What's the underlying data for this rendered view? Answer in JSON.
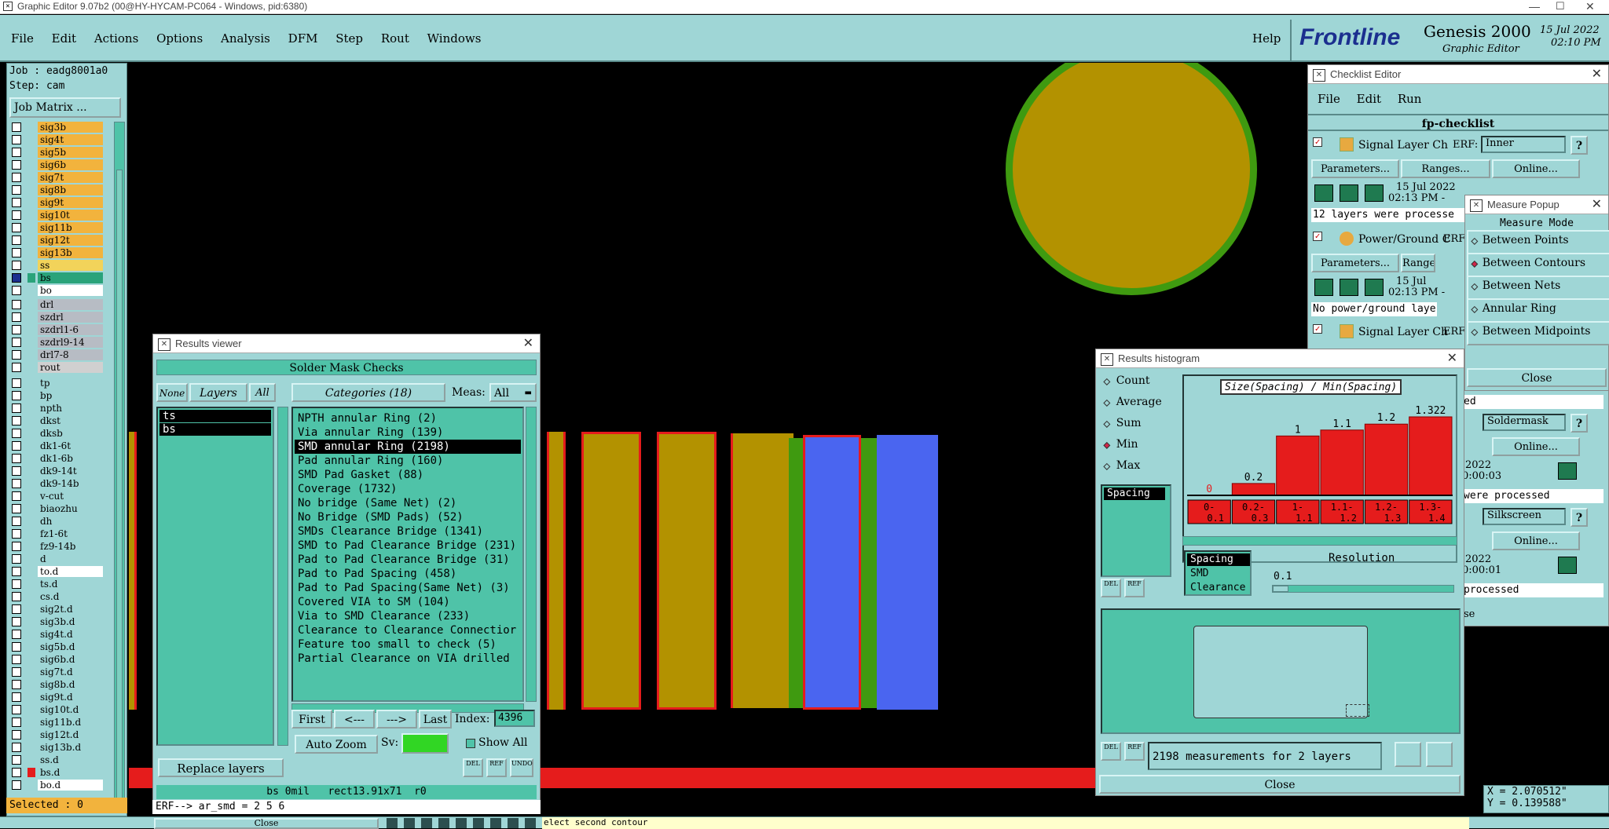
{
  "titlebar": {
    "title": "Graphic Editor 9.07b2 (00@HY-HYCAM-PC064 - Windows, pid:6380)"
  },
  "menu": {
    "items": [
      "File",
      "Edit",
      "Actions",
      "Options",
      "Analysis",
      "DFM",
      "Step",
      "Rout",
      "Windows"
    ],
    "help": "Help"
  },
  "brand": {
    "logo": "Frontline",
    "product": "Genesis 2000",
    "subtitle": "Graphic Editor",
    "date": "15 Jul 2022",
    "time": "02:10 PM"
  },
  "job": {
    "job": "Job : eadg8001a0",
    "step": "Step: cam",
    "matrix_button": "Job Matrix ...",
    "selected": "Selected : 0"
  },
  "layers": [
    {
      "name": "sig3b",
      "color": "#f2b33d"
    },
    {
      "name": "sig4t",
      "color": "#f2b33d"
    },
    {
      "name": "sig5b",
      "color": "#f2b33d"
    },
    {
      "name": "sig6b",
      "color": "#f2b33d"
    },
    {
      "name": "sig7t",
      "color": "#f2b33d"
    },
    {
      "name": "sig8b",
      "color": "#f2b33d"
    },
    {
      "name": "sig9t",
      "color": "#f2b33d"
    },
    {
      "name": "sig10t",
      "color": "#f2b33d"
    },
    {
      "name": "sig11b",
      "color": "#f2b33d"
    },
    {
      "name": "sig12t",
      "color": "#f2b33d"
    },
    {
      "name": "sig13b",
      "color": "#f2b33d"
    },
    {
      "name": "ss",
      "color": "#f2d35a"
    },
    {
      "name": "bs",
      "color": "#2aa37a",
      "active": true
    },
    {
      "name": "bo",
      "color": "#ffffff"
    },
    {
      "name": "drl",
      "color": "#b7bcc4"
    },
    {
      "name": "szdrl",
      "color": "#b7bcc4"
    },
    {
      "name": "szdrl1-6",
      "color": "#b7bcc4"
    },
    {
      "name": "szdrl9-14",
      "color": "#b7bcc4"
    },
    {
      "name": "drl7-8",
      "color": "#b7bcc4"
    },
    {
      "name": "rout",
      "color": "#d0d0d0"
    },
    {
      "name": "tp",
      "color": "#9fd6d6"
    },
    {
      "name": "bp",
      "color": "#9fd6d6"
    },
    {
      "name": "npth",
      "color": "#9fd6d6"
    },
    {
      "name": "dkst",
      "color": "#9fd6d6"
    },
    {
      "name": "dksb",
      "color": "#9fd6d6"
    },
    {
      "name": "dk1-6t",
      "color": "#9fd6d6"
    },
    {
      "name": "dk1-6b",
      "color": "#9fd6d6"
    },
    {
      "name": "dk9-14t",
      "color": "#9fd6d6"
    },
    {
      "name": "dk9-14b",
      "color": "#9fd6d6"
    },
    {
      "name": "v-cut",
      "color": "#9fd6d6"
    },
    {
      "name": "biaozhu",
      "color": "#9fd6d6"
    },
    {
      "name": "dh",
      "color": "#9fd6d6"
    },
    {
      "name": "fz1-6t",
      "color": "#9fd6d6"
    },
    {
      "name": "fz9-14b",
      "color": "#9fd6d6"
    },
    {
      "name": "d",
      "color": "#9fd6d6"
    },
    {
      "name": "to.d",
      "color": "#ffffff"
    },
    {
      "name": "ts.d",
      "color": "#9fd6d6"
    },
    {
      "name": "cs.d",
      "color": "#9fd6d6"
    },
    {
      "name": "sig2t.d",
      "color": "#9fd6d6"
    },
    {
      "name": "sig3b.d",
      "color": "#9fd6d6"
    },
    {
      "name": "sig4t.d",
      "color": "#9fd6d6"
    },
    {
      "name": "sig5b.d",
      "color": "#9fd6d6"
    },
    {
      "name": "sig6b.d",
      "color": "#9fd6d6"
    },
    {
      "name": "sig7t.d",
      "color": "#9fd6d6"
    },
    {
      "name": "sig8b.d",
      "color": "#9fd6d6"
    },
    {
      "name": "sig9t.d",
      "color": "#9fd6d6"
    },
    {
      "name": "sig10t.d",
      "color": "#9fd6d6"
    },
    {
      "name": "sig11b.d",
      "color": "#9fd6d6"
    },
    {
      "name": "sig12t.d",
      "color": "#9fd6d6"
    },
    {
      "name": "sig13b.d",
      "color": "#9fd6d6"
    },
    {
      "name": "ss.d",
      "color": "#9fd6d6"
    },
    {
      "name": "bs.d",
      "color": "#9fd6d6"
    },
    {
      "name": "bo.d",
      "color": "#ffffff"
    }
  ],
  "results_viewer": {
    "title": "Results viewer",
    "header": "Solder Mask Checks",
    "none_btn": "None",
    "layers_btn": "Layers",
    "all_btn": "All",
    "categories_label": "Categories (18)",
    "meas_label": "Meas:",
    "meas_value": "All",
    "layer_items": [
      "ts",
      "bs"
    ],
    "categories": [
      "NPTH annular Ring (2)",
      "Via annular Ring (139)",
      "SMD annular Ring (2198)",
      "Pad annular Ring (160)",
      "SMD Pad Gasket (88)",
      "Coverage (1732)",
      "No bridge (Same Net) (2)",
      "No Bridge (SMD Pads) (52)",
      "SMDs Clearance Bridge (1341)",
      "SMD to Pad Clearance Bridge (231)",
      "Pad to Pad Clearance Bridge (31)",
      "Pad to Pad Spacing (458)",
      "Pad to Pad Spacing(Same Net) (3)",
      "Covered VIA to SM (104)",
      "Via to SMD Clearance (233)",
      "Clearance to Clearance Connectior",
      "Feature too small to check (5)",
      "Partial Clearance on VIA drilled"
    ],
    "selected_category": 2,
    "first_btn": "First",
    "prev_btn": "<---",
    "next_btn": "--->",
    "last_btn": "Last",
    "index_label": "Index:",
    "index_value": "4396",
    "zoom_label": "Auto Zoom",
    "sv_label": "Sv:",
    "show_all": "Show All",
    "replace_label": "Replace layers",
    "icon_del": "DEL",
    "icon_ref": "REF",
    "icon_undo": "UNDO",
    "info": "bs 0mil   rect13.91x71  r0"
  },
  "command_line": "ERF--> ar_smd = 2 5 6",
  "histogram": {
    "title": "Results histogram",
    "modes": [
      "Count",
      "Average",
      "Sum",
      "Min",
      "Max"
    ],
    "active_mode": "Min",
    "chart_title": "Size(Spacing) / Min(Spacing)",
    "list_item": "Spacing",
    "resolution_items": [
      "Spacing",
      "SMD",
      "Clearance"
    ],
    "resolution_label": "Resolution",
    "resolution_value": "0.1",
    "status": "2198 measurements for 2 layers",
    "close": "Close"
  },
  "chart_data": {
    "type": "bar",
    "title": "Size(Spacing) / Min(Spacing)",
    "categories": [
      "0-0.1",
      "0.2-0.3",
      "1-1.1",
      "1.1-1.2",
      "1.2-1.3",
      "1.3-1.4"
    ],
    "values": [
      0,
      0.2,
      1,
      1.1,
      1.2,
      1.322
    ],
    "bar_color": "#e51c1c"
  },
  "checklist": {
    "title": "Checklist Editor",
    "menu": [
      "File",
      "Edit",
      "Run"
    ],
    "name": "fp-checklist",
    "rows": [
      {
        "label": "Signal Layer Ch",
        "erf": "ERF:",
        "value": "Inner",
        "date": "15 Jul 2022",
        "time": "02:13 PM -",
        "status": "12 layers were processe"
      },
      {
        "label": "Power/Ground C",
        "erf": "ERF",
        "value": "",
        "date": "15 Jul",
        "time": "02:13 PM -",
        "status": "No power/ground layers"
      },
      {
        "label": "Signal Layer Ch",
        "erf": "ERF",
        "value": ""
      }
    ],
    "params_btn": "Parameters...",
    "ranges_btn": "Ranges...",
    "online_btn": "Online...",
    "right_rows": [
      {
        "value": "Soldermask",
        "date": "2022",
        "time": "0:00:03",
        "status": "were processed"
      },
      {
        "value": "Silkscreen",
        "date": "2022",
        "time": "0:00:01",
        "status": "processed"
      }
    ],
    "ed": "ed",
    "se": "se"
  },
  "measure": {
    "title": "Measure Popup",
    "mode_label": "Measure Mode",
    "modes": [
      "Between Points",
      "Between Contours",
      "Between Nets",
      "Annular Ring",
      "Between Midpoints"
    ],
    "active": "Between Contours",
    "close": "Close"
  },
  "coords": {
    "x": "X = 2.070512\"",
    "y": "Y = 0.139588\""
  },
  "bottom": {
    "close": "Close",
    "status": "elect second contour"
  }
}
